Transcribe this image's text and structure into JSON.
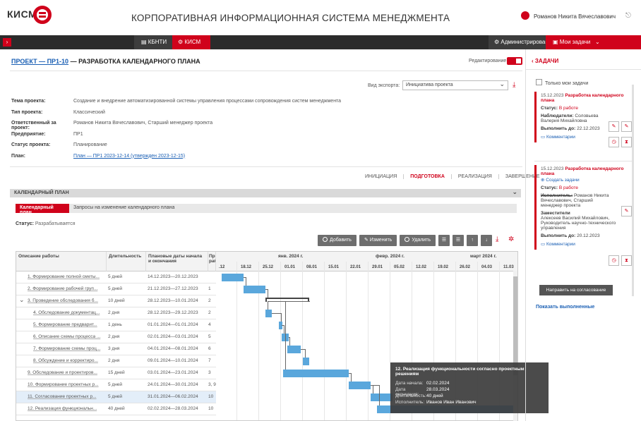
{
  "app": {
    "logo": "КИСМ",
    "title": "КОРПОРАТИВНАЯ ИНФОРМАЦИОННАЯ СИСТЕМА МЕНЕДЖМЕНТА",
    "user": "Романов Никита Вячеславович"
  },
  "topbar": {
    "tabs": [
      "КБНТИ",
      "КИСМ"
    ],
    "admin": "Администрирование",
    "my_tasks": "Мои задачи"
  },
  "project": {
    "link": "ПРОЕКТ — ПР1-10",
    "title": " — РАЗРАБОТКА КАЛЕНДАРНОГО ПЛАНА",
    "edit_label": "Редактирование",
    "export_label": "Вид экспорта:",
    "export_value": "Инициатива проекта",
    "fields": [
      {
        "k": "Тема проекта:",
        "v": "Создание и внедрение автоматизированной системы управления процессами сопровождения систем менеджмента"
      },
      {
        "k": "Тип проекта:",
        "v": "Классический"
      },
      {
        "k": "Ответственный за проект:",
        "v": "Романов Никита Вячеславович, Старший менеджер проекта"
      },
      {
        "k": "Предприятие:",
        "v": "ПР1"
      },
      {
        "k": "Статус проекта:",
        "v": "Планирование"
      },
      {
        "k": "План:",
        "v": "План — ПР1 2023-12-14 (утвержден 2023-12-15)"
      }
    ],
    "phases": [
      "ИНИЦИАЦИЯ",
      "ПОДГОТОВКА",
      "РЕАЛИЗАЦИЯ",
      "ЗАВЕРШЕНИЕ"
    ]
  },
  "calendar": {
    "section_title": "КАЛЕНДАРНЫЙ ПЛАН",
    "tab_active": "Календарный план",
    "tab_other": "Запросы на изменение календарного плана",
    "status_label": "Статус:",
    "status_value": "Разрабатывается",
    "buttons": {
      "add": "Добавить",
      "edit": "Изменить",
      "delete": "Удалить"
    },
    "headers": {
      "work": "Описание работы",
      "duration": "Длительность",
      "dates": "Плановые даты начала и окончания",
      "pred": "Пре раб"
    },
    "months": [
      "янв. 2024 г.",
      "февр. 2024 г.",
      "март 2024 г."
    ],
    "days": [
      ".12",
      "18.12",
      "25.12",
      "01.01",
      "08.01",
      "15.01",
      "22.01",
      "29.01",
      "05.02",
      "12.02",
      "19.02",
      "26.02",
      "04.03",
      "11.03"
    ],
    "rows": [
      {
        "name": "1. Формирование полной сметы...",
        "dur": "5 дней",
        "dates": "14.12.2023—20.12.2023",
        "pred": "",
        "start": 0.0,
        "len": 1.0
      },
      {
        "name": "2. Формирование рабочей груп...",
        "dur": "5 дней",
        "dates": "21.12.2023—27.12.2023",
        "pred": "1",
        "start": 1.0,
        "len": 1.0
      },
      {
        "name": "3. Проведение обследования б...",
        "dur": "10 дней",
        "dates": "28.12.2023—10.01.2024",
        "pred": "2",
        "start": 2.0,
        "len": 2.0
      },
      {
        "name": "4. Обследование документац...",
        "dur": "2 дня",
        "dates": "28.12.2023—29.12.2023",
        "pred": "2",
        "start": 2.0,
        "len": 0.3
      },
      {
        "name": "5. Формирование предварит...",
        "dur": "1 день",
        "dates": "01.01.2024—01.01.2024",
        "pred": "4",
        "start": 2.6,
        "len": 0.15
      },
      {
        "name": "6. Описание схемы процесса ...",
        "dur": "2 дня",
        "dates": "02.01.2024—03.01.2024",
        "pred": "5",
        "start": 2.75,
        "len": 0.3
      },
      {
        "name": "7. Формирование схемы проц...",
        "dur": "3 дня",
        "dates": "04.01.2024—08.01.2024",
        "pred": "6",
        "start": 3.0,
        "len": 0.6
      },
      {
        "name": "8. Обсуждение и корректиро...",
        "dur": "2 дня",
        "dates": "09.01.2024—10.01.2024",
        "pred": "7",
        "start": 3.7,
        "len": 0.3
      },
      {
        "name": "9. Обследование и проектиров...",
        "dur": "15 дней",
        "dates": "03.01.2024—23.01.2024",
        "pred": "3",
        "start": 2.8,
        "len": 3.0
      },
      {
        "name": "10. Формирование проектных р...",
        "dur": "5 дней",
        "dates": "24.01.2024—30.01.2024",
        "pred": "3, 9",
        "start": 5.8,
        "len": 1.0
      },
      {
        "name": "11. Согласование проектных р...",
        "dur": "5 дней",
        "dates": "31.01.2024—06.02.2024",
        "pred": "10",
        "start": 6.8,
        "len": 1.0
      },
      {
        "name": "12. Реализация функциональн...",
        "dur": "40 дней",
        "dates": "02.02.2024—28.03.2024",
        "pred": "10",
        "start": 7.1,
        "len": 6.9
      }
    ],
    "tooltip": {
      "title": "12. Реализация функциональности согласно проектным решениям",
      "start_k": "Дата начала:",
      "start_v": "02.02.2024",
      "end_k": "Дата окончания:",
      "end_v": "28.03.2024",
      "dur_k": "Длительность:",
      "dur_v": "40 дней",
      "exec_k": "Исполнитель:",
      "exec_v": "Иванов Иван Иванович"
    }
  },
  "tasks": {
    "title": "ЗАДАЧИ",
    "only_mine": "Только мои задачи",
    "card1": {
      "date": "15.12.2023",
      "title": "Разработка календарного плана",
      "status_k": "Статус:",
      "status_v": "В работе",
      "observers_k": "Наблюдатели:",
      "observers_v": "Соловьева Валерия Михайловна",
      "due_k": "Выполнить до:",
      "due_v": "22.12.2023",
      "comments": "Комментарии"
    },
    "card2": {
      "date": "15.12.2023",
      "title": "Разработка календарного плана",
      "create": "Создать задачи",
      "status_k": "Статус:",
      "status_v": "В работе",
      "exec_k": "Исполнитель:",
      "exec_v": "Романов Никита Вячеславович, Старший менеджер проекта",
      "deputy_k": "Заместители",
      "deputy_v": "Алексеев Василий Михайлович, Руководитель научно-технического управления",
      "due_k": "Выполнить до:",
      "due_v": "20.12.2023",
      "comments": "Комментарии",
      "send": "Направить на согласование"
    },
    "show_done": "Показать выполненные"
  }
}
